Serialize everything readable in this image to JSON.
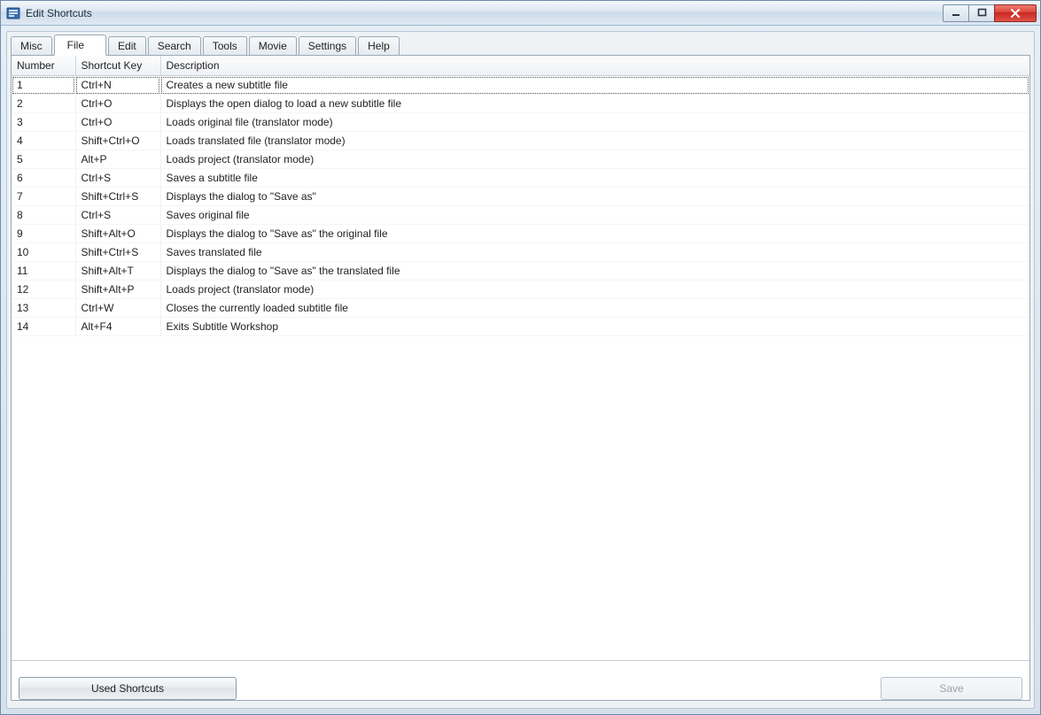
{
  "window": {
    "title": "Edit Shortcuts"
  },
  "tabs": [
    {
      "label": "Misc",
      "active": false
    },
    {
      "label": "File",
      "active": true
    },
    {
      "label": "Edit",
      "active": false
    },
    {
      "label": "Search",
      "active": false
    },
    {
      "label": "Tools",
      "active": false
    },
    {
      "label": "Movie",
      "active": false
    },
    {
      "label": "Settings",
      "active": false
    },
    {
      "label": "Help",
      "active": false
    }
  ],
  "table": {
    "columns": {
      "number": "Number",
      "shortcut": "Shortcut Key",
      "description": "Description"
    },
    "rows": [
      {
        "number": "1",
        "shortcut": "Ctrl+N",
        "description": "Creates a new subtitle file"
      },
      {
        "number": "2",
        "shortcut": "Ctrl+O",
        "description": "Displays the open dialog to load a new subtitle file"
      },
      {
        "number": "3",
        "shortcut": "Ctrl+O",
        "description": "Loads original file (translator mode)"
      },
      {
        "number": "4",
        "shortcut": "Shift+Ctrl+O",
        "description": "Loads translated file (translator mode)"
      },
      {
        "number": "5",
        "shortcut": "Alt+P",
        "description": "Loads project (translator mode)"
      },
      {
        "number": "6",
        "shortcut": "Ctrl+S",
        "description": "Saves a subtitle file"
      },
      {
        "number": "7",
        "shortcut": "Shift+Ctrl+S",
        "description": "Displays the dialog to \"Save as\""
      },
      {
        "number": "8",
        "shortcut": "Ctrl+S",
        "description": "Saves original file"
      },
      {
        "number": "9",
        "shortcut": "Shift+Alt+O",
        "description": "Displays the dialog to \"Save as\" the original file"
      },
      {
        "number": "10",
        "shortcut": "Shift+Ctrl+S",
        "description": "Saves translated file"
      },
      {
        "number": "11",
        "shortcut": "Shift+Alt+T",
        "description": "Displays the dialog to \"Save as\" the translated file"
      },
      {
        "number": "12",
        "shortcut": "Shift+Alt+P",
        "description": "Loads project (translator mode)"
      },
      {
        "number": "13",
        "shortcut": "Ctrl+W",
        "description": "Closes the currently loaded subtitle file"
      },
      {
        "number": "14",
        "shortcut": "Alt+F4",
        "description": "Exits Subtitle Workshop"
      }
    ]
  },
  "buttons": {
    "used_shortcuts": "Used Shortcuts",
    "save": "Save"
  }
}
